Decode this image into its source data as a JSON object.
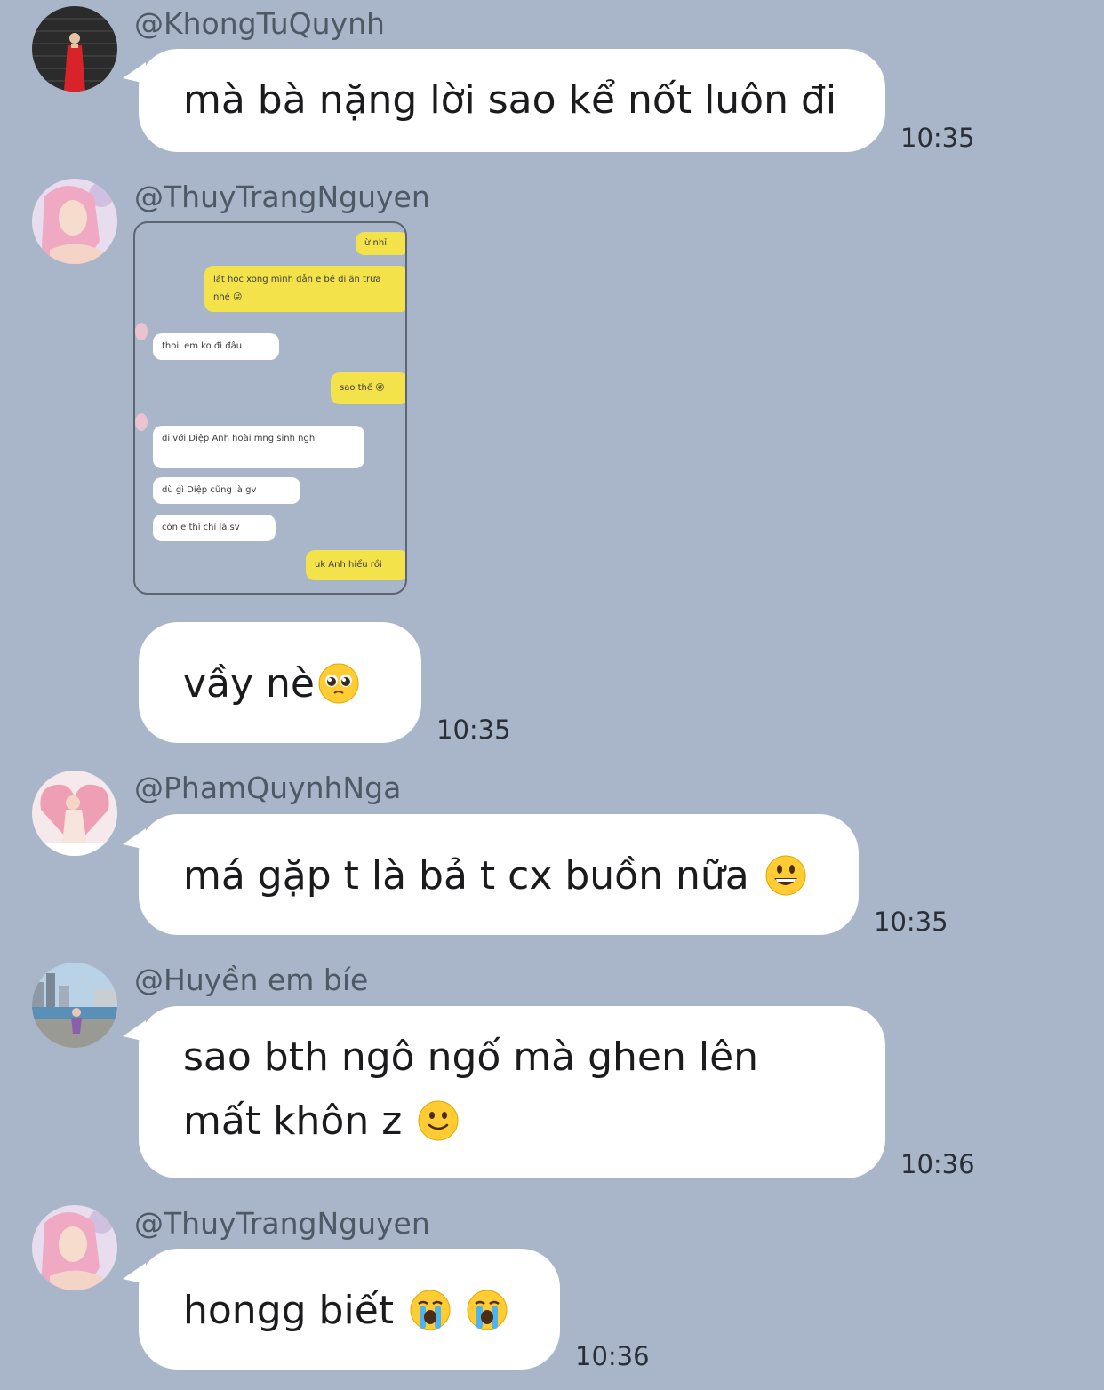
{
  "colors": {
    "background": "#a9b6c9",
    "bubble": "#ffffff",
    "username": "#4f5865",
    "timestamp": "#2a2f37",
    "quoted_outgoing_bubble": "#f3e24a"
  },
  "messages": [
    {
      "username": "@KhongTuQuynh",
      "avatar": "avatar-woman-red-dress",
      "text": "mà bà nặng lời sao kể nốt luôn đi",
      "time": "10:35"
    },
    {
      "username": "@ThuyTrangNguyen",
      "avatar": "avatar-pink-hair-woman",
      "image": {
        "type": "chat-screenshot",
        "bubbles": [
          {
            "side": "right",
            "text": "ừ nhỉ"
          },
          {
            "side": "right",
            "text": "lát học xong mình dẫn e bé đi ăn trưa nhé 😜"
          },
          {
            "side": "left",
            "text": "thoii em ko đi đâu"
          },
          {
            "side": "right",
            "text": "sao thế 😜"
          },
          {
            "side": "left",
            "text": "đi với Diệp Anh hoài mng sinh nghi"
          },
          {
            "side": "left",
            "text": "dù gì Diệp cũng là gv"
          },
          {
            "side": "left",
            "text": "còn e thì chỉ là sv"
          },
          {
            "side": "right",
            "text": "uk Anh hiểu rồi"
          }
        ]
      },
      "text": "vầy nè",
      "emoji": "pleading-face-emoji",
      "time": "10:35"
    },
    {
      "username": "@PhamQuynhNga",
      "avatar": "avatar-woman-pink-heart",
      "text": "má gặp t là bả t cx buồn nữa",
      "emoji": "grinning-face-emoji",
      "time": "10:35"
    },
    {
      "username": "@Huyền em bíe",
      "avatar": "avatar-woman-harbour",
      "text_line1": "sao bth ngô ngố mà ghen lên",
      "text_line2": "mất khôn z",
      "emoji": "slightly-smiling-face-emoji",
      "time": "10:36"
    },
    {
      "username": "@ThuyTrangNguyen",
      "avatar": "avatar-pink-hair-woman",
      "text": "hongg biết",
      "emoji": "loudly-crying-face-emoji",
      "emoji_count": 2,
      "time": "10:36"
    }
  ]
}
